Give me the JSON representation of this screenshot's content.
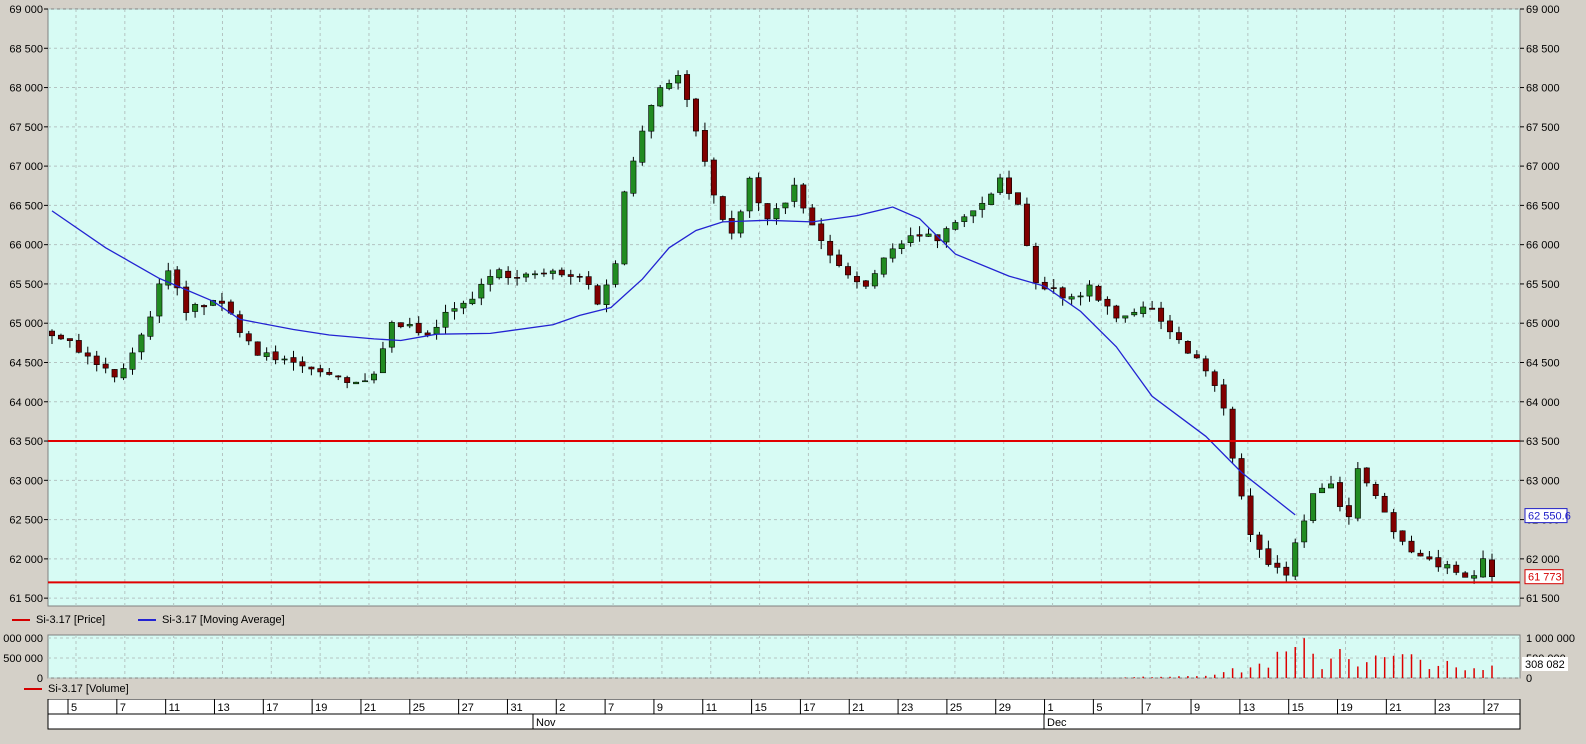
{
  "colors": {
    "plot_background": "#d7fbf4",
    "grid": "#b4c4c2",
    "candle_up": "#218b21",
    "candle_down": "#800000",
    "moving_average": "#2323d2",
    "support_resistance": "#e00000",
    "volume_bar": "#dd0000",
    "last_price_box": "#d40000",
    "ma_box": "#2020c8"
  },
  "legend": {
    "price": "Si-3.17 [Price]",
    "moving_average": "Si-3.17 [Moving Average]",
    "volume": "Si-3.17 [Volume]"
  },
  "badges": {
    "moving_average_last": "62 550.6",
    "last_price": "61 773",
    "volume_last": "308 082"
  },
  "chart_data": [
    {
      "type": "candlestick",
      "ylim": [
        61400,
        69000
      ],
      "yticks": [
        {
          "value": 61500,
          "label": "61 500"
        },
        {
          "value": 62000,
          "label": "62 000"
        },
        {
          "value": 62500,
          "label": "62 500"
        },
        {
          "value": 63000,
          "label": "63 000"
        },
        {
          "value": 63500,
          "label": "63 500"
        },
        {
          "value": 64000,
          "label": "64 000"
        },
        {
          "value": 64500,
          "label": "64 500"
        },
        {
          "value": 65000,
          "label": "65 000"
        },
        {
          "value": 65500,
          "label": "65 500"
        },
        {
          "value": 66000,
          "label": "66 000"
        },
        {
          "value": 66500,
          "label": "66 500"
        },
        {
          "value": 67000,
          "label": "67 000"
        },
        {
          "value": 67500,
          "label": "67 500"
        },
        {
          "value": 68000,
          "label": "68 000"
        },
        {
          "value": 68500,
          "label": "68 500"
        },
        {
          "value": 69000,
          "label": "69 000"
        }
      ],
      "horizontal_lines": [
        63500,
        61700
      ],
      "moving_average": [
        [
          0,
          66430
        ],
        [
          12,
          65960
        ],
        [
          24,
          65570
        ],
        [
          36,
          65280
        ],
        [
          42,
          65050
        ],
        [
          54,
          64920
        ],
        [
          62,
          64850
        ],
        [
          72,
          64800
        ],
        [
          78,
          64780
        ],
        [
          86,
          64860
        ],
        [
          98,
          64870
        ],
        [
          112,
          64980
        ],
        [
          118,
          65100
        ],
        [
          125,
          65200
        ],
        [
          132,
          65560
        ],
        [
          138,
          65960
        ],
        [
          144,
          66180
        ],
        [
          150,
          66290
        ],
        [
          160,
          66310
        ],
        [
          170,
          66290
        ],
        [
          180,
          66370
        ],
        [
          188,
          66480
        ],
        [
          194,
          66330
        ],
        [
          202,
          65880
        ],
        [
          214,
          65600
        ],
        [
          222,
          65470
        ],
        [
          230,
          65150
        ],
        [
          238,
          64700
        ],
        [
          246,
          64070
        ],
        [
          258,
          63560
        ],
        [
          266,
          63100
        ],
        [
          278,
          62560
        ]
      ],
      "last_price": 61773,
      "ma_last": 62550.6
    },
    {
      "type": "bar",
      "title": "Volume",
      "ylim": [
        0,
        1000000
      ],
      "yticks": [
        {
          "value": 0,
          "label": "0"
        },
        {
          "value": 500000,
          "label": "500 000"
        },
        {
          "value": 1000000,
          "label": "1 000 000"
        }
      ],
      "last_volume": 308082
    }
  ],
  "date_axis": {
    "day_labels": [
      "5",
      "7",
      "11",
      "13",
      "17",
      "19",
      "21",
      "25",
      "27",
      "31",
      "2",
      "7",
      "9",
      "11",
      "15",
      "17",
      "21",
      "23",
      "25",
      "29",
      "1",
      "5",
      "7",
      "9",
      "13",
      "15",
      "19",
      "21",
      "23",
      "27"
    ],
    "month_labels": [
      "Nov",
      "Dec"
    ]
  }
}
